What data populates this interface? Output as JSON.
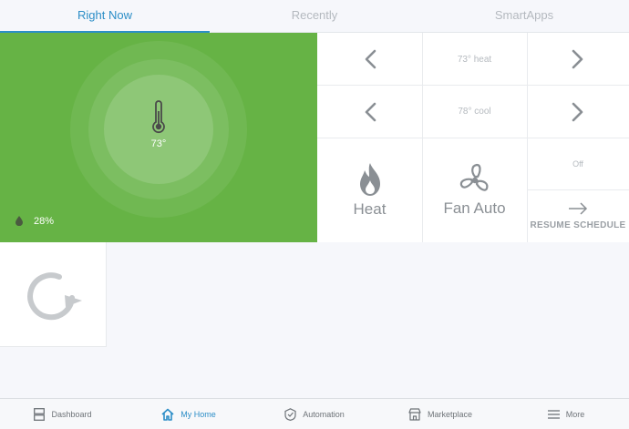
{
  "tabs": [
    {
      "label": "Right Now",
      "active": true
    },
    {
      "label": "Recently",
      "active": false
    },
    {
      "label": "SmartApps",
      "active": false
    }
  ],
  "thermostat": {
    "temperature": "73°",
    "humidity": "28%",
    "tile_color": "#66b345"
  },
  "controls": {
    "heat_setpoint": "73° heat",
    "cool_setpoint": "78° cool",
    "mode_label": "Heat",
    "fan_label": "Fan Auto",
    "state_label": "Off",
    "resume_label": "RESUME SCHEDULE"
  },
  "bottom_nav": [
    {
      "label": "Dashboard",
      "icon": "dashboard-icon",
      "active": false
    },
    {
      "label": "My Home",
      "icon": "house-icon",
      "active": true
    },
    {
      "label": "Automation",
      "icon": "automation-icon",
      "active": false
    },
    {
      "label": "Marketplace",
      "icon": "store-icon",
      "active": false
    },
    {
      "label": "More",
      "icon": "menu-icon",
      "active": false
    }
  ],
  "accent_color": "#2c8ec7"
}
